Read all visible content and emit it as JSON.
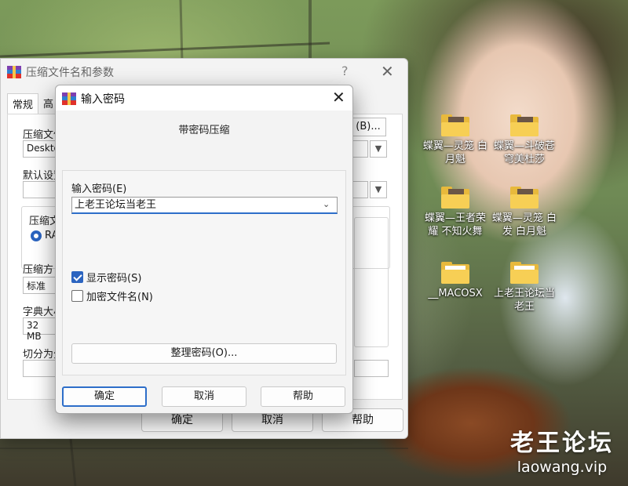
{
  "desktop": {
    "icons": [
      {
        "label": "蝶翼—灵笼 白月魁"
      },
      {
        "label": "蝶翼—斗破苍 穹美杜莎"
      },
      {
        "label": "蝶翼—王者荣 耀 不知火舞"
      },
      {
        "label": "蝶翼—灵笼 白发 白月魁"
      },
      {
        "label": "__MACOSX"
      },
      {
        "label": "上老王论坛当 老王"
      }
    ],
    "watermark": {
      "title": "老王论坛",
      "url": "laowang.vip"
    }
  },
  "main_dialog": {
    "title": "压缩文件名和参数",
    "help": "?",
    "close": "✕",
    "tabs": [
      "常规",
      "高"
    ],
    "archive_name_label": "压缩文件",
    "archive_name_value": "Deskto",
    "browse_label": "(B)...",
    "default_profile_label": "默认设置",
    "format_group_label": "压缩文",
    "format_radio_label": "RA",
    "method_label": "压缩方",
    "method_value": "标准",
    "dict_label": "字典大小",
    "dict_value": "32 MB",
    "split_label": "切分为分",
    "ok_label": "确定",
    "cancel_label": "取消",
    "help_label": "帮助"
  },
  "password_dialog": {
    "title": "输入密码",
    "close": "✕",
    "subtitle": "带密码压缩",
    "password_label": "输入密码(E)",
    "password_value": "上老王论坛当老王",
    "show_password_label": "显示密码(S)",
    "show_password_checked": true,
    "encrypt_names_label": "加密文件名(N)",
    "encrypt_names_checked": false,
    "organize_label": "整理密码(O)...",
    "ok_label": "确定",
    "cancel_label": "取消",
    "help_label": "帮助"
  },
  "colors": {
    "accent": "#2d6ec9",
    "folder": "#f7cf55"
  }
}
